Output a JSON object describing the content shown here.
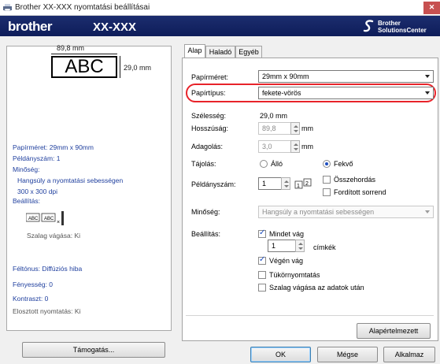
{
  "window": {
    "title": "Brother XX-XXX nyomtatási beállításai",
    "close_label": "✕"
  },
  "header": {
    "brand": "brother",
    "model": "XX-XXX",
    "solutions_line1": "Brother",
    "solutions_line2": "SolutionsCenter"
  },
  "preview": {
    "width_label": "89,8 mm",
    "height_label": "29,0 mm",
    "sample_text": "ABC"
  },
  "summary": {
    "paper_size": "Papírméret: 29mm x 90mm",
    "copies": "Példányszám: 1",
    "quality_heading": "Minőség:",
    "quality_value": "Hangsúly a nyomtatási sebességen",
    "resolution": "300 x 300 dpi",
    "settings_heading": "Beállítás:",
    "cut_label": "Szalag vágása: Ki",
    "halftone": "Féltónus: Diffúziós hiba",
    "brightness": "Fényesség:  0",
    "contrast": "Kontraszt:  0",
    "split_print": "Elosztott nyomtatás: Ki"
  },
  "support_button": "Támogatás...",
  "tabs": [
    {
      "label": "Alap"
    },
    {
      "label": "Haladó"
    },
    {
      "label": "Egyéb"
    }
  ],
  "form": {
    "paper_size_label": "Papírméret:",
    "paper_size_value": "29mm x 90mm",
    "paper_type_label": "Papírtípus:",
    "paper_type_value": "fekete-vörös",
    "width_label": "Szélesség:",
    "width_value": "29,0 mm",
    "length_label": "Hosszúság:",
    "length_value": "89,8",
    "length_unit": "mm",
    "feed_label": "Adagolás:",
    "feed_value": "3,0",
    "feed_unit": "mm",
    "orientation_label": "Tájolás:",
    "portrait_label": "Álló",
    "landscape_label": "Fekvő",
    "copies_label": "Példányszám:",
    "copies_value": "1",
    "collate_label": "Összehordás",
    "reverse_label": "Fordított sorrend",
    "quality_label": "Minőség:",
    "quality_value": "Hangsúly a nyomtatási sebességen",
    "settings_label": "Beállítás:",
    "cut_all_label": "Mindet vág",
    "cut_every_value": "1",
    "labels_unit": "címkék",
    "cut_end_label": "Végén vág",
    "mirror_label": "Tükörnyomtatás",
    "cut_after_label": "Szalag vágása az adatok után",
    "defaults_button": "Alapértelmezett"
  },
  "footer": {
    "ok": "OK",
    "cancel": "Mégse",
    "apply": "Alkalmaz"
  },
  "colors": {
    "brand_bar": "#0e1d5a",
    "info_text": "#1f3f9e",
    "highlight": "#e8232a",
    "close_button": "#c75050"
  }
}
